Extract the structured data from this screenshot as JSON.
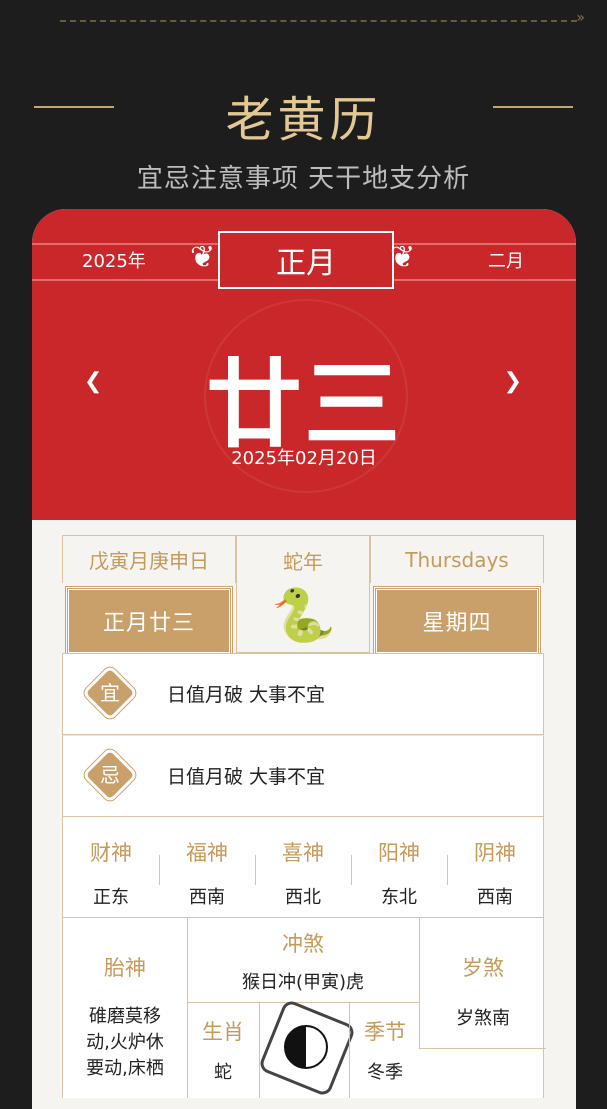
{
  "hero": {
    "title": "老黄历",
    "subtitle": "宜忌注意事项  天干地支分析"
  },
  "calendar": {
    "year": "2025年",
    "month": "正月",
    "next_month": "二月",
    "lunar_day": "廿三",
    "solar_date": "2025年02月20日"
  },
  "info": {
    "ganzhi": "戊寅月庚申日",
    "zodiac_year": "蛇年",
    "weekday_en": "Thursdays",
    "lunar_date": "正月廿三",
    "weekday_cn": "星期四"
  },
  "yi": {
    "label": "宜",
    "text": "日值月破 大事不宜"
  },
  "ji": {
    "label": "忌",
    "text": "日值月破 大事不宜"
  },
  "gods": [
    {
      "name": "财神",
      "dir": "正东"
    },
    {
      "name": "福神",
      "dir": "西南"
    },
    {
      "name": "喜神",
      "dir": "西北"
    },
    {
      "name": "阳神",
      "dir": "东北"
    },
    {
      "name": "阴神",
      "dir": "西南"
    }
  ],
  "bottom": {
    "taishen_label": "胎神",
    "taishen_value": "碓磨莫移动,火炉休要动,床栖",
    "chongsha_label": "冲煞",
    "chongsha_value": "猴日冲(甲寅)虎",
    "suisha_label": "岁煞",
    "suisha_value": "岁煞南",
    "shengxiao_label": "生肖",
    "shengxiao_value": "蛇",
    "jijie_label": "季节",
    "jijie_value": "冬季"
  },
  "colors": {
    "red": "#c9272a",
    "gold": "#caa06a",
    "bg": "#1d1d1d"
  }
}
